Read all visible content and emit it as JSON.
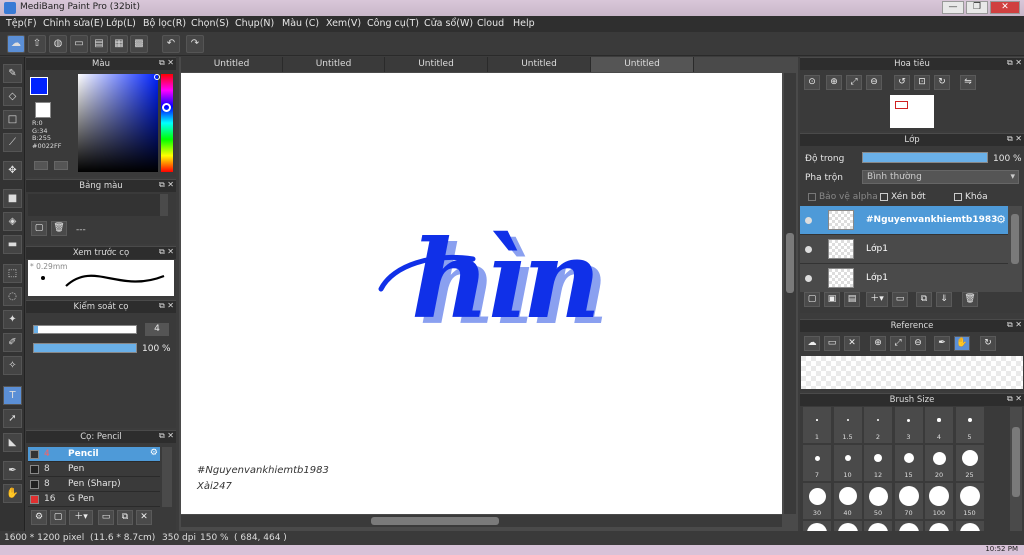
{
  "window": {
    "title": "MediBang Paint Pro (32bit)",
    "buttons": [
      "—",
      "❐",
      "✕"
    ],
    "restore_label": "❐"
  },
  "menu": [
    "Tệp(F)",
    "Chỉnh sửa(E)",
    "Lớp(L)",
    "Bộ lọc(R)",
    "Chọn(S)",
    "Chụp(N)",
    "Màu (C)",
    "Xem(V)",
    "Công cụ(T)",
    "Cửa sổ(W)",
    "Cloud",
    "Help"
  ],
  "doc_tabs": [
    "Untitled",
    "Untitled",
    "Untitled",
    "Untitled",
    "Untitled"
  ],
  "color_panel": {
    "title": "Màu",
    "fg_color": "#0022ff",
    "values": [
      "R:0",
      "G:34",
      "B:255",
      "#0022FF"
    ]
  },
  "palette_panel": {
    "title": "Bảng màu",
    "value": "---"
  },
  "brush_preview": {
    "title": "Xem trước cọ",
    "size": "* 0.29mm"
  },
  "brush_control": {
    "title": "Kiểm soát cọ",
    "size_value": "4",
    "opacity_value": "100 %",
    "opacity_fraction": 1.0
  },
  "brush_list": {
    "title": "Cọ: Pencil",
    "items": [
      {
        "size": "4",
        "name": "Pencil",
        "selected": true,
        "swatch": "#333333"
      },
      {
        "size": "8",
        "name": "Pen",
        "selected": false,
        "swatch": "#222222"
      },
      {
        "size": "8",
        "name": "Pen (Sharp)",
        "selected": false,
        "swatch": "#222222"
      },
      {
        "size": "16",
        "name": "G Pen",
        "selected": false,
        "swatch": "#e03030"
      }
    ]
  },
  "canvas": {
    "main_text": "hìn",
    "signature_line1": "#Nguyenvankhiemtb1983",
    "signature_line2": "Xài247",
    "ink_color": "#1030e8",
    "shadow_color": "#8aa0f0"
  },
  "navigator_panel": {
    "title": "Hoa tiêu"
  },
  "layer_panel": {
    "title": "Lớp",
    "opacity_label": "Độ trong",
    "opacity_value": "100 %",
    "opacity_fraction": 1.0,
    "blend_label": "Pha trộn",
    "blend_value": "Bình thường",
    "protect_alpha": "Bảo vệ alpha",
    "clipping": "Xén bớt",
    "lock": "Khóa",
    "layers": [
      {
        "name": "#Nguyenvankhiemtb1983",
        "selected": true
      },
      {
        "name": "Lớp1",
        "selected": false
      },
      {
        "name": "Lớp1",
        "selected": false
      }
    ]
  },
  "reference_panel": {
    "title": "Reference"
  },
  "brush_size_panel": {
    "title": "Brush Size",
    "row_labels": [
      [
        "1",
        "1.5",
        "2",
        "3",
        "4",
        "5"
      ],
      [
        "7",
        "10",
        "12",
        "15",
        "20",
        "25"
      ],
      [
        "30",
        "40",
        "50",
        "70",
        "100",
        "150"
      ]
    ]
  },
  "status": {
    "size": "1600 * 1200 pixel",
    "physical": "(11.6 * 8.7cm)",
    "dpi": "350 dpi",
    "zoom": "150 %",
    "coords": "( 684, 464 )"
  },
  "taskbar": {
    "clock": "10:52 PM"
  }
}
